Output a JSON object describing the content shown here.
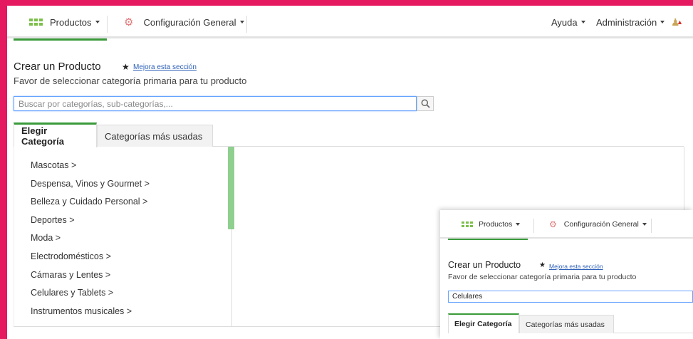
{
  "nav": {
    "products_label": "Productos",
    "config_label": "Configuración General",
    "help_label": "Ayuda",
    "admin_label": "Administración"
  },
  "page": {
    "title": "Crear un Producto",
    "improve_link": "Mejora esta sección",
    "subtitle": "Favor de seleccionar categoría primaria para tu producto",
    "search_placeholder": "Buscar por categorías, sub-categorías,...",
    "search_value": ""
  },
  "tabs": {
    "choose_category": "Elegir Categoría",
    "most_used": "Categorías más usadas"
  },
  "categories": [
    "Mascotas >",
    "Despensa, Vinos y Gourmet >",
    "Belleza y Cuidado Personal >",
    "Deportes >",
    "Moda >",
    "Electrodomésticos >",
    "Cámaras y Lentes >",
    "Celulares y Tablets >",
    "Instrumentos musicales >"
  ],
  "overlay": {
    "products_label": "Productos",
    "config_label": "Configuración General",
    "title": "Crear un Producto",
    "improve_link": "Mejora esta sección",
    "subtitle": "Favor de seleccionar categoría primaria para tu producto",
    "search_value": "Celulares",
    "tab_choose_category": "Elegir Categoría",
    "tab_most_used": "Categorías más usadas"
  },
  "icons": {
    "apps": "apps-grid-icon",
    "gear": "gear-icon",
    "user": "user-alert-icon",
    "star": "star-icon",
    "search": "search-icon"
  },
  "colors": {
    "accent_green": "#3a9a3a",
    "link_blue": "#2c5fb8",
    "background_pink": "#e5195f",
    "scroll_green": "#8fcf8f"
  }
}
